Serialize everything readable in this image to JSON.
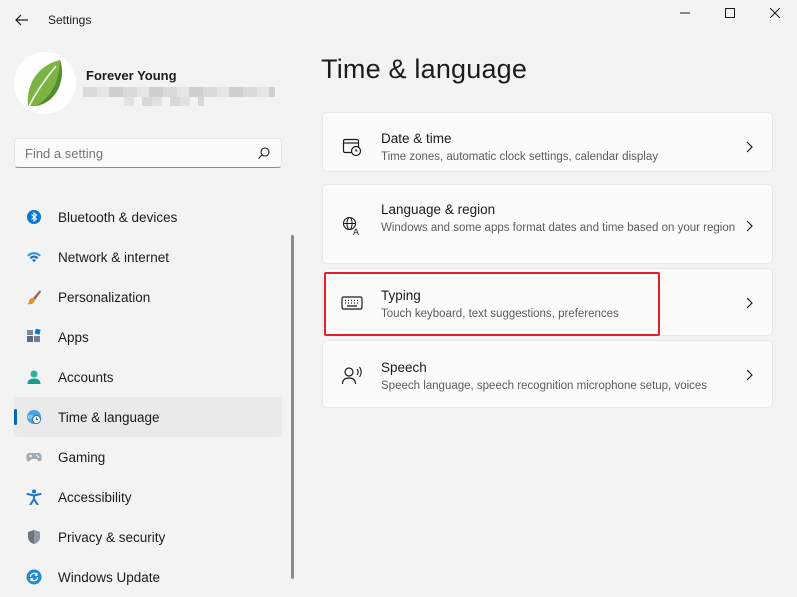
{
  "window": {
    "title": "Settings"
  },
  "profile": {
    "name": "Forever Young"
  },
  "search": {
    "placeholder": "Find a setting"
  },
  "sidebar": {
    "items": [
      {
        "label": "Bluetooth & devices",
        "icon": "bluetooth-icon"
      },
      {
        "label": "Network & internet",
        "icon": "wifi-icon"
      },
      {
        "label": "Personalization",
        "icon": "brush-icon"
      },
      {
        "label": "Apps",
        "icon": "apps-icon"
      },
      {
        "label": "Accounts",
        "icon": "person-icon"
      },
      {
        "label": "Time & language",
        "icon": "globe-clock-icon",
        "selected": true
      },
      {
        "label": "Gaming",
        "icon": "gamepad-icon"
      },
      {
        "label": "Accessibility",
        "icon": "accessibility-icon"
      },
      {
        "label": "Privacy & security",
        "icon": "shield-icon"
      },
      {
        "label": "Windows Update",
        "icon": "update-icon"
      }
    ]
  },
  "main": {
    "title": "Time & language",
    "cards": [
      {
        "title": "Date & time",
        "desc": "Time zones, automatic clock settings, calendar display",
        "icon": "calendar-clock-icon"
      },
      {
        "title": "Language & region",
        "desc": "Windows and some apps format dates and time based on your region",
        "icon": "language-icon"
      },
      {
        "title": "Typing",
        "desc": "Touch keyboard, text suggestions, preferences",
        "icon": "keyboard-icon",
        "highlighted": true
      },
      {
        "title": "Speech",
        "desc": "Speech language, speech recognition microphone setup, voices",
        "icon": "speech-icon"
      }
    ]
  },
  "colors": {
    "accent": "#0067c0",
    "highlight_box": "#e81d25",
    "background": "#f3f3f3",
    "card": "#fbfbfb"
  }
}
